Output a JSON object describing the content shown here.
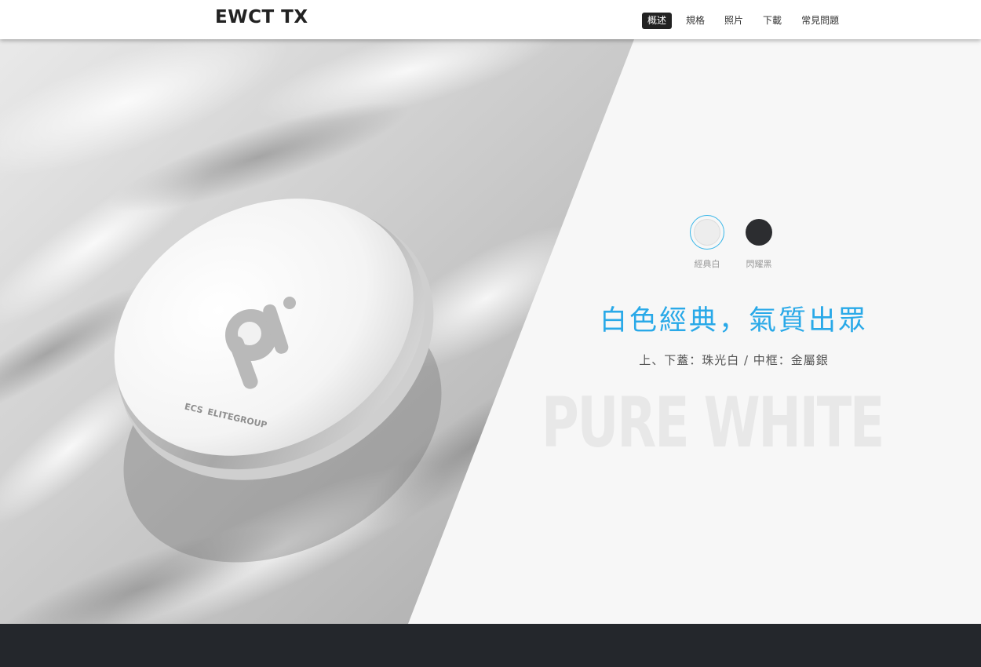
{
  "header": {
    "brand": "EWCT TX",
    "nav": [
      {
        "label": "概述",
        "active": true
      },
      {
        "label": "規格",
        "active": false
      },
      {
        "label": "照片",
        "active": false
      },
      {
        "label": "下載",
        "active": false
      },
      {
        "label": "常見問題",
        "active": false
      }
    ]
  },
  "product": {
    "logo_text": "ELITEGROUP",
    "logo_mark": "ECS"
  },
  "colors": {
    "accent": "#29a9e8",
    "selected_ring": "#36b5e8",
    "footer": "#24272c"
  },
  "swatches": [
    {
      "label": "經典白",
      "color": "#ededed",
      "selected": true
    },
    {
      "label": "閃耀黑",
      "color": "#2c2d30",
      "selected": false
    }
  ],
  "hero": {
    "headline": "白色經典，氣質出眾",
    "subline": "上、下蓋：珠光白 / 中框：金屬銀",
    "background_text": "PURE WHITE"
  }
}
